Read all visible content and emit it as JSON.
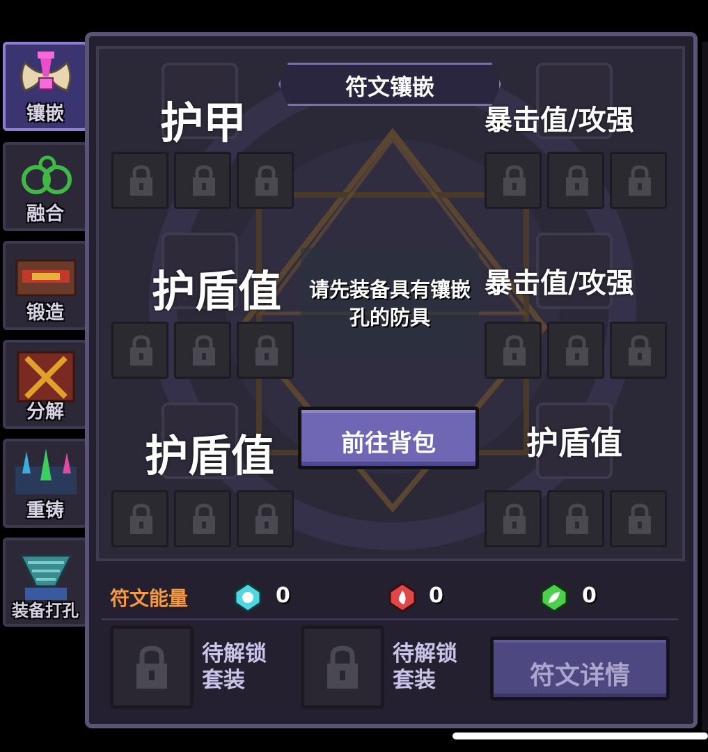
{
  "tabs": [
    {
      "label": "镶嵌",
      "icon": "inlay-icon",
      "active": true
    },
    {
      "label": "融合",
      "icon": "fusion-icon",
      "active": false
    },
    {
      "label": "锻造",
      "icon": "forge-icon",
      "active": false
    },
    {
      "label": "分解",
      "icon": "decompose-icon",
      "active": false
    },
    {
      "label": "重铸",
      "icon": "recast-icon",
      "active": false
    },
    {
      "label": "装备打孔",
      "icon": "socket-drill-icon",
      "active": false
    }
  ],
  "title": "符文镶嵌",
  "labels": {
    "top_left": "护甲",
    "top_right": "暴击值/攻强",
    "mid_left": "护盾值",
    "mid_right": "暴击值/攻强",
    "bottom_left": "护盾值",
    "bottom_right": "护盾值"
  },
  "center_note": "请先装备具有镶嵌孔的防具",
  "goto_button": "前往背包",
  "energy": {
    "title": "符文能量",
    "items": [
      {
        "icon": "cyan-gem-icon",
        "value": "0",
        "color": "#4fd8e0"
      },
      {
        "icon": "red-gem-icon",
        "value": "0",
        "color": "#e04848"
      },
      {
        "icon": "green-gem-icon",
        "value": "0",
        "color": "#4cd04c"
      }
    ]
  },
  "sets": [
    {
      "line1": "待解锁",
      "line2": "套装"
    },
    {
      "line1": "待解锁",
      "line2": "套装"
    }
  ],
  "detail_button": "符文详情"
}
